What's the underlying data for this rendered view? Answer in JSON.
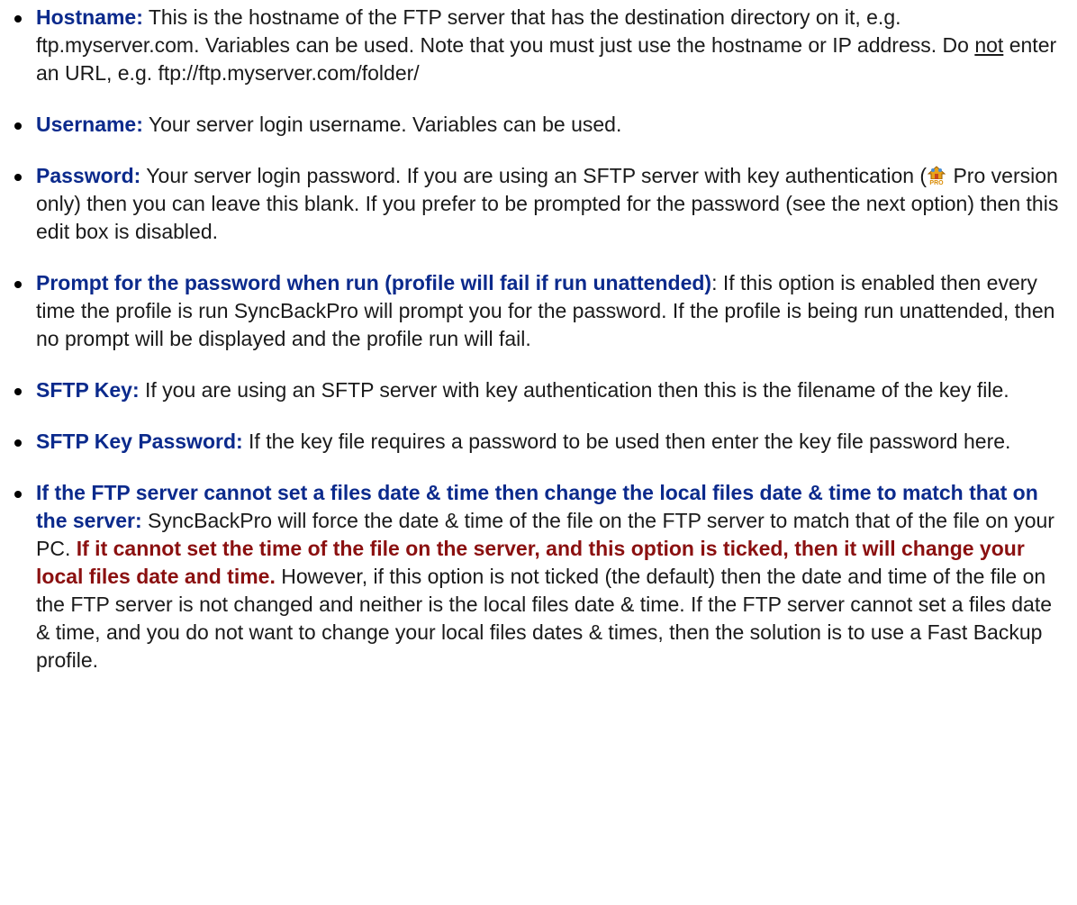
{
  "items": [
    {
      "term": "Hostname:",
      "text_a": " This is the hostname of the FTP server that has the destination directory on it, e.g. ftp.myserver.com. Variables can be used. Note that you must just use the hostname or IP address. Do ",
      "underlined": "not",
      "text_b": " enter an URL, e.g. ftp://ftp.myserver.com/folder/"
    },
    {
      "term": "Username:",
      "text": " Your server login username. Variables can be used."
    },
    {
      "term": "Password:",
      "text_a": " Your server login password. If you are using an SFTP server with key authentication (",
      "icon": "pro-version-icon",
      "text_b": " Pro version only) then you can leave this blank. If you prefer to be prompted for the password (see the next option) then this edit box is disabled."
    },
    {
      "term": "Prompt for the password when run (profile will fail if run unattended)",
      "text": ": If this option is enabled then every time the profile is run SyncBackPro will prompt you for the password. If the profile is being run unattended, then no prompt will be displayed and the profile run will fail."
    },
    {
      "term": "SFTP Key:",
      "text": " If you are using an SFTP server with key authentication then this is the filename of the key file."
    },
    {
      "term": "SFTP Key Password:",
      "text": " If the key file requires a password to be used then enter the key file password here."
    },
    {
      "term": "If the FTP server cannot set a files date & time then change the local files date & time to match that on the server:",
      "text_a": " SyncBackPro will force the date & time of the file on the FTP server to match that of the file on your PC. ",
      "warning": "If it cannot set the time of the file on the server, and this option is ticked, then it will change your local files date and time.",
      "text_b": " However, if this option is not ticked (the default) then the date and time of the file on the FTP server is not changed and neither is the local files date & time. If the FTP server cannot set a files date & time, and you do not want to change your local files dates & times, then the solution is to use a Fast Backup profile."
    }
  ],
  "colors": {
    "term": "#0b2a8c",
    "warning": "#8b1010",
    "body_text": "#1a1a1a"
  }
}
